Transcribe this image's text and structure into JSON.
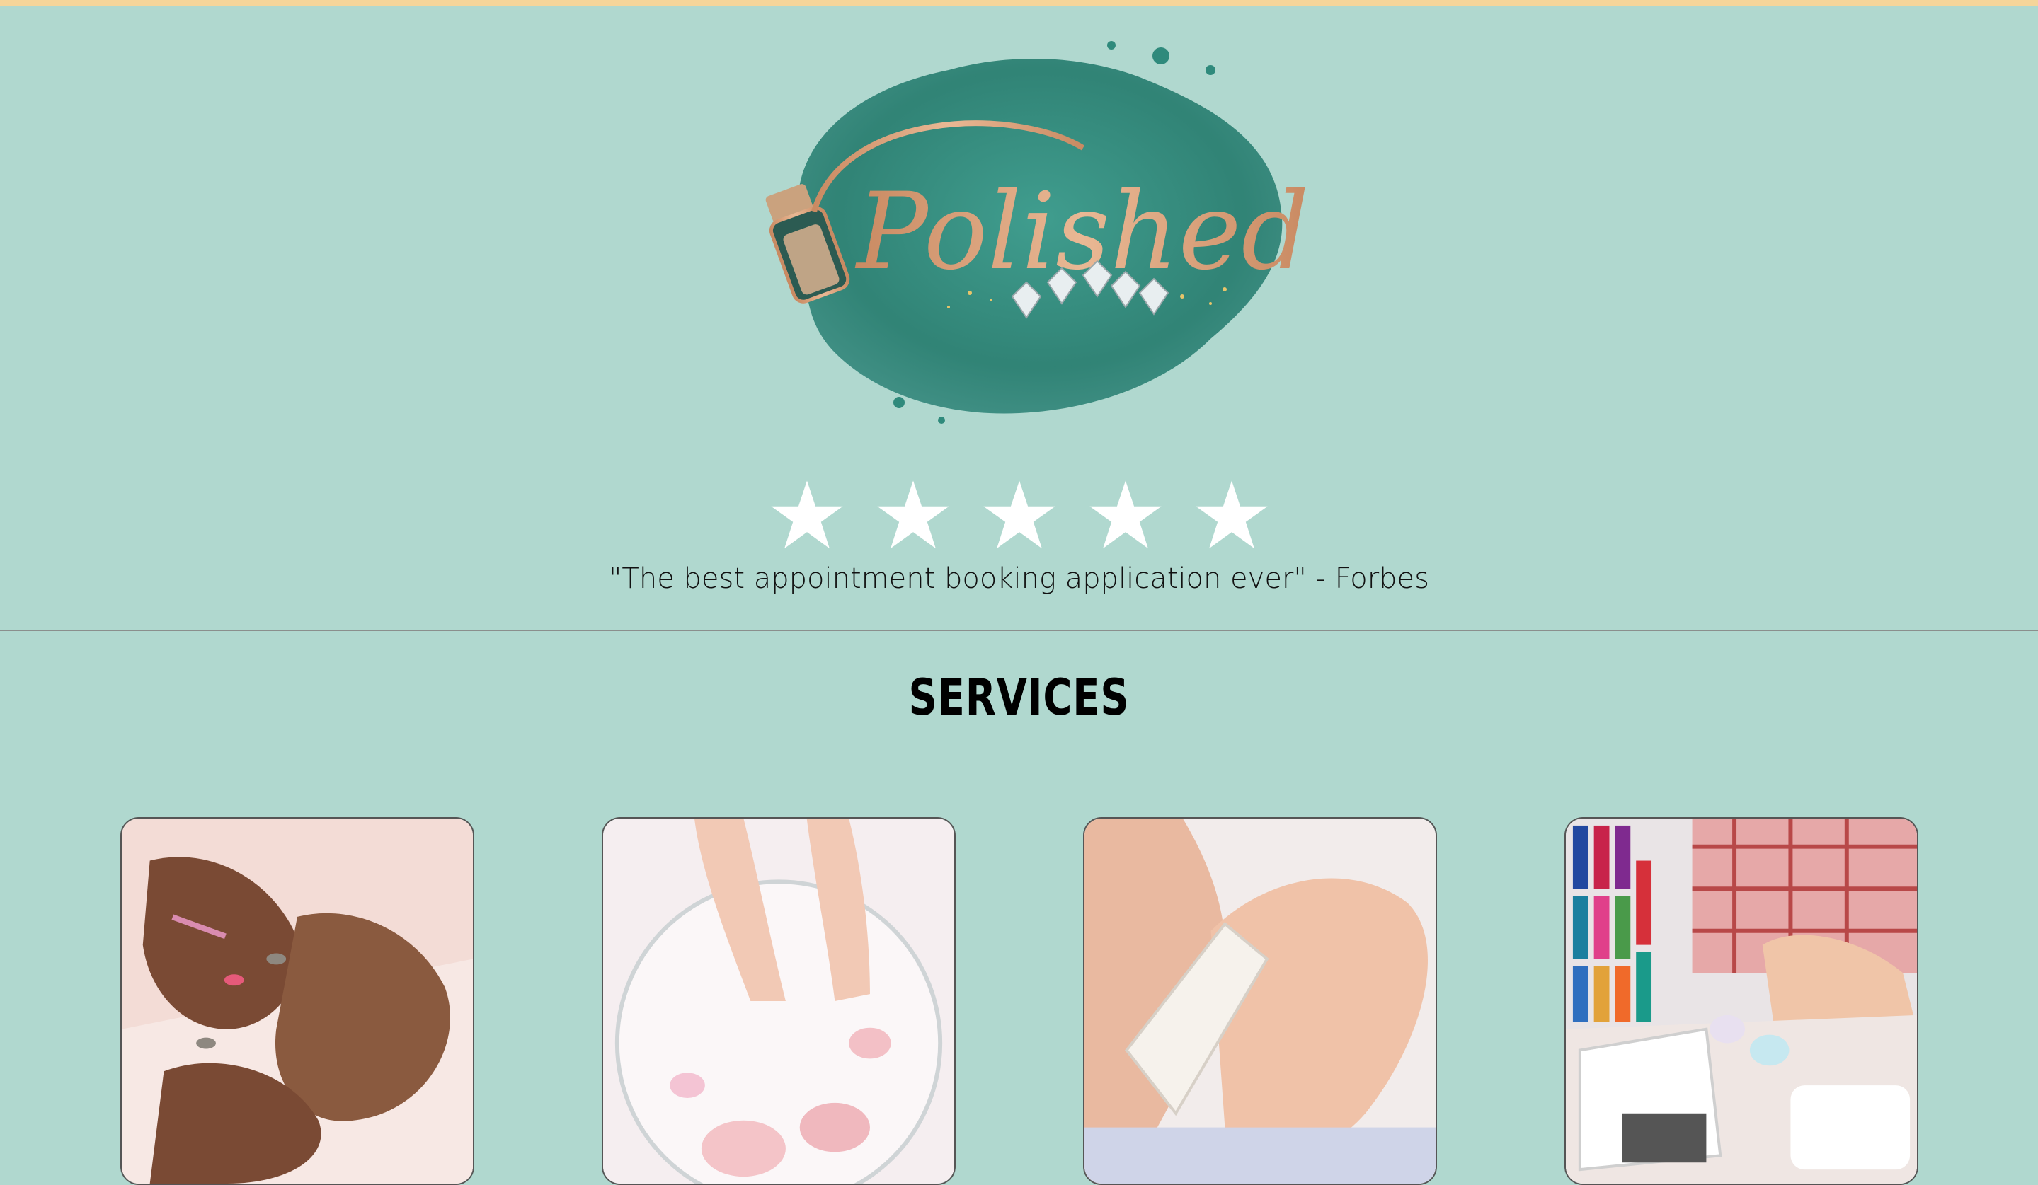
{
  "brand": {
    "logo_text": "Polished"
  },
  "review": {
    "star_count": 5,
    "rating": 5,
    "quote": "\"The best appointment booking application ever\" - Forbes"
  },
  "services": {
    "title": "SERVICES"
  },
  "colors": {
    "background": "#b0d8cf",
    "top_bar": "#f5d59a",
    "logo_green": "#2f8a7c",
    "logo_gold": "#d9a07a",
    "star": "#ffffff"
  }
}
